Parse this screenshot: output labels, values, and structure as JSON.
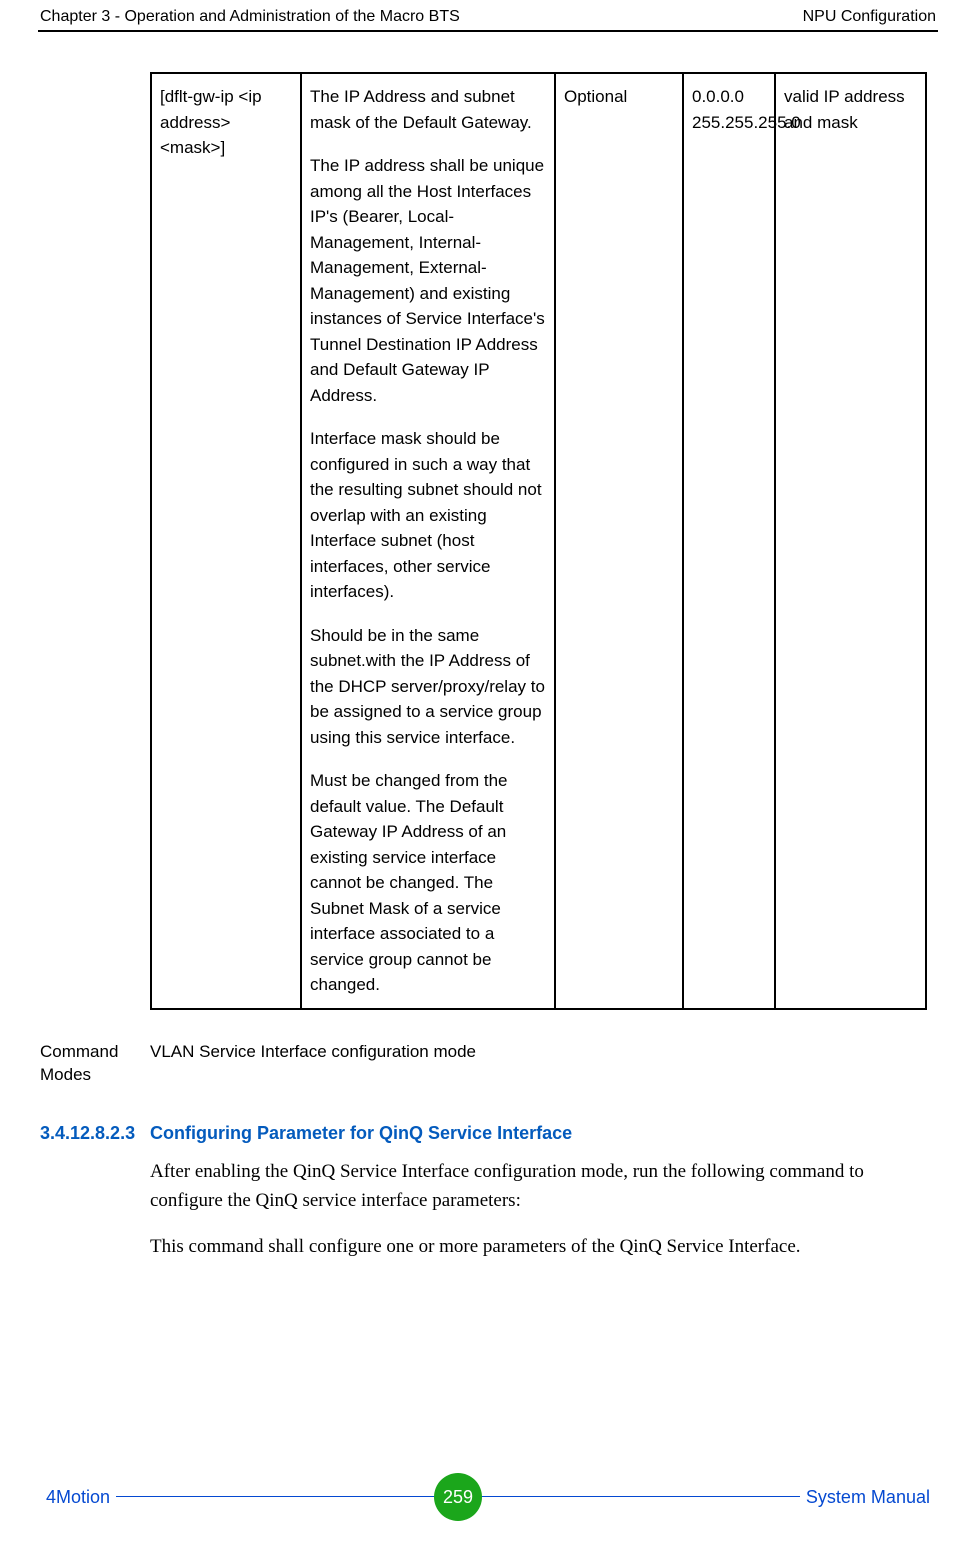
{
  "header": {
    "left": "Chapter 3 - Operation and Administration of the Macro BTS",
    "right": "NPU Configuration"
  },
  "table": {
    "c1": "[dflt-gw-ip <ip address> <mask>]",
    "c2_p1": "The IP Address and subnet mask of the Default Gateway.",
    "c2_p2": "The IP address shall be unique among all the Host Interfaces IP's (Bearer, Local-Management, Internal-Management, External-Management) and existing instances of Service Interface's Tunnel Destination IP Address and Default Gateway IP Address.",
    "c2_p3": "Interface mask should be configured in such a way that the resulting subnet should not overlap with an existing Interface subnet (host interfaces, other service interfaces).",
    "c2_p4": "Should be in the same subnet.with the IP Address of the DHCP server/proxy/relay to be assigned to a service group using this service interface.",
    "c2_p5": "Must be changed from the default value. The Default Gateway IP Address of an existing service interface cannot be changed. The Subnet Mask of a service interface associated to a service group cannot be changed.",
    "c3": "Optional",
    "c4": "0.0.0.0 255.255.255.0",
    "c5": "valid IP address and mask"
  },
  "modes": {
    "label": "Command Modes",
    "value": "VLAN Service Interface configuration mode"
  },
  "section": {
    "number": "3.4.12.8.2.3",
    "title": "Configuring Parameter for QinQ Service Interface",
    "para1": "After enabling the QinQ Service Interface configuration mode, run the following command to configure the QinQ service interface parameters:",
    "para2": "This command shall configure one or more parameters of the QinQ Service Interface."
  },
  "footer": {
    "left": "4Motion",
    "page": "259",
    "right": "System Manual"
  }
}
